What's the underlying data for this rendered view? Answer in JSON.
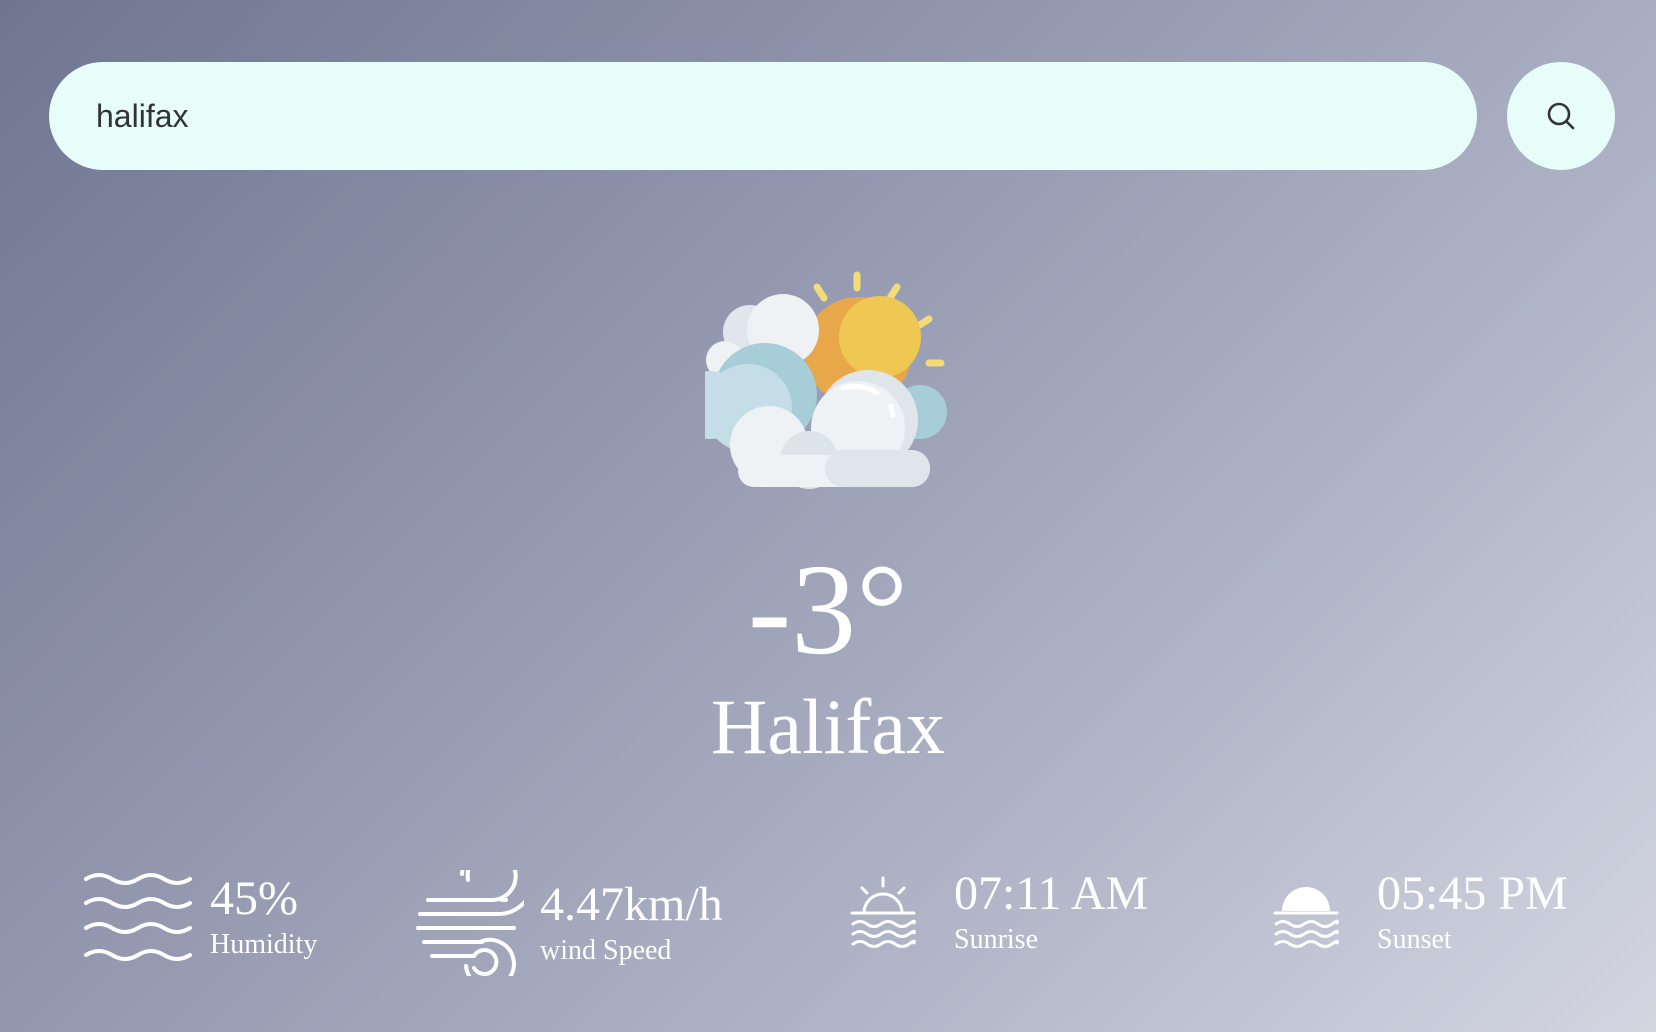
{
  "search": {
    "value": "halifax",
    "button_icon": "search-icon"
  },
  "weather": {
    "icon": "partly-cloudy-icon",
    "temperature": "-3°",
    "city": "Halifax"
  },
  "stats": {
    "humidity": {
      "value": "45%",
      "label": "Humidity",
      "icon": "humidity-waves-icon"
    },
    "wind": {
      "value": "4.47km/h",
      "label": "wind Speed",
      "icon": "wind-icon"
    },
    "sunrise": {
      "value": "07:11 AM",
      "label": "Sunrise",
      "icon": "sunrise-icon"
    },
    "sunset": {
      "value": "05:45 PM",
      "label": "Sunset",
      "icon": "sunset-icon"
    }
  },
  "colors": {
    "search_bg": "#e6fdf9",
    "text": "#ffffff",
    "sun_outer": "#e8a84a",
    "sun_inner": "#efc854",
    "cloud_light": "#eef2f4",
    "cloud_blue": "#b8d7e1"
  }
}
